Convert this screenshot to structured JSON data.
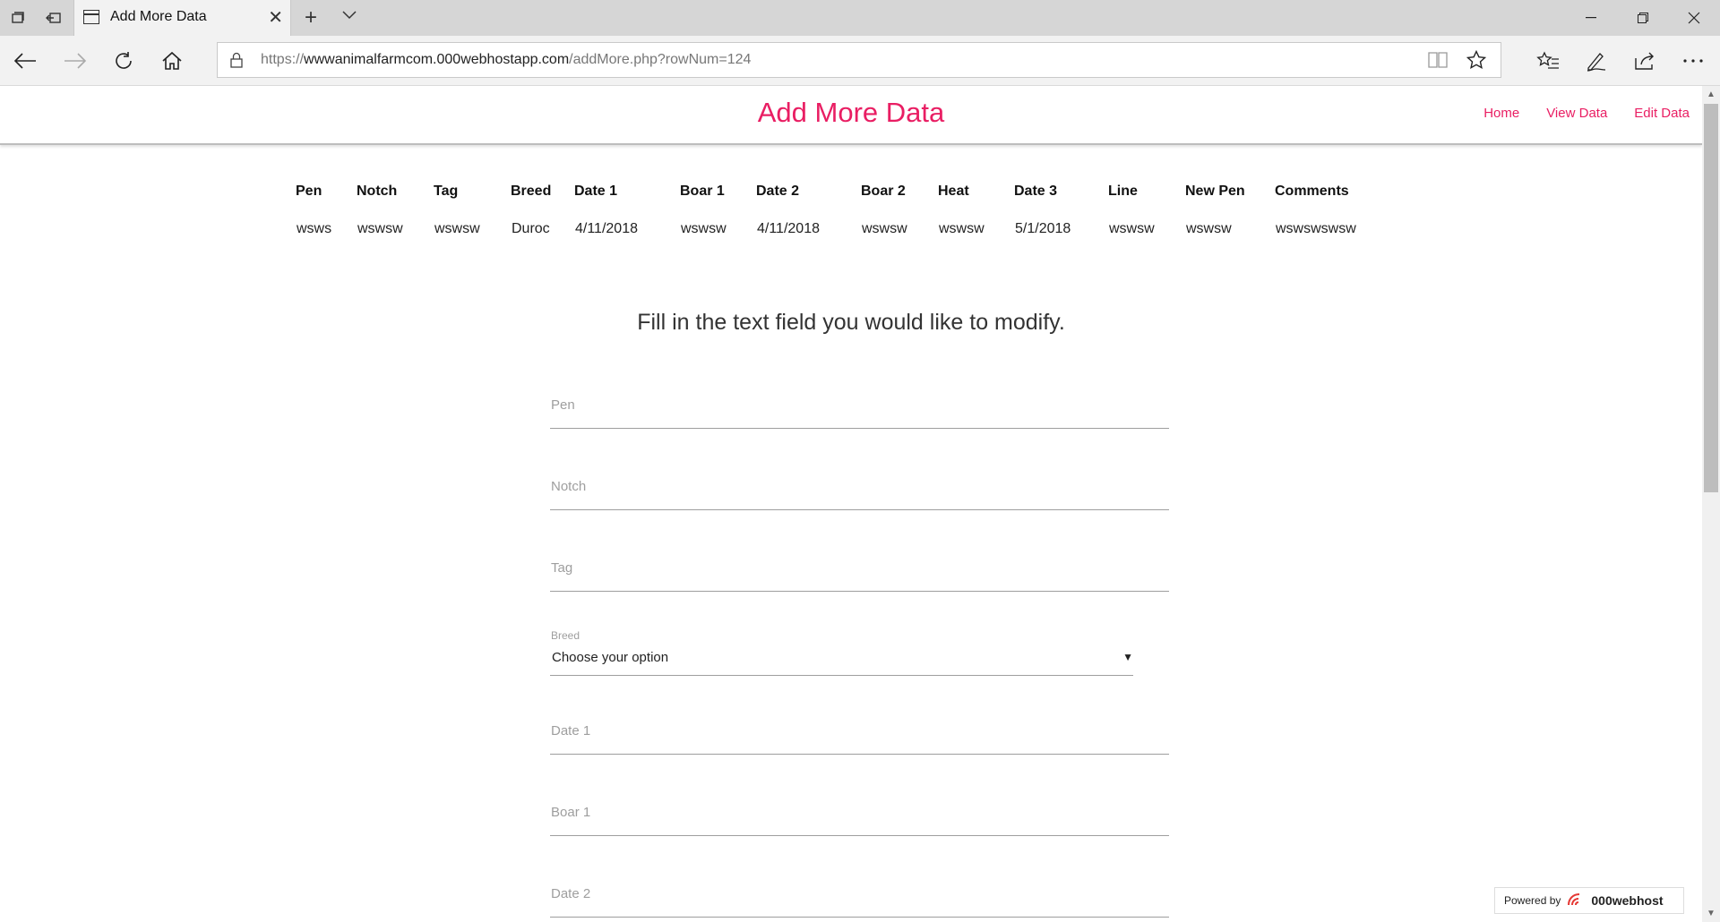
{
  "browser": {
    "tab_title": "Add More Data",
    "url_prefix": "https://",
    "url_host": "wwwanimalfarmcom.000webhostapp.com",
    "url_path": "/addMore.php?rowNum=124"
  },
  "site": {
    "title": "Add More Data",
    "nav": [
      "Home",
      "View Data",
      "Edit Data"
    ]
  },
  "table": {
    "headers": [
      "Pen",
      "Notch",
      "Tag",
      "Breed",
      "Date 1",
      "Boar 1",
      "Date 2",
      "Boar 2",
      "Heat",
      "Date 3",
      "Line",
      "New Pen",
      "Comments"
    ],
    "row": [
      "wsws",
      "wswsw",
      "wswsw",
      "Duroc",
      "4/11/2018",
      "wswsw",
      "4/11/2018",
      "wswsw",
      "wswsw",
      "5/1/2018",
      "wswsw",
      "wswsw",
      "wswswswsw"
    ]
  },
  "instructions": "Fill in the text field you would like to modify.",
  "form": {
    "pen_placeholder": "Pen",
    "notch_placeholder": "Notch",
    "tag_placeholder": "Tag",
    "breed_label": "Breed",
    "breed_value": "Choose your option",
    "date1_placeholder": "Date 1",
    "boar1_placeholder": "Boar 1",
    "date2_placeholder": "Date 2"
  },
  "footer": {
    "powered_by": "Powered by",
    "brand": "000webhost"
  },
  "colors": {
    "accent": "#e91e63"
  }
}
